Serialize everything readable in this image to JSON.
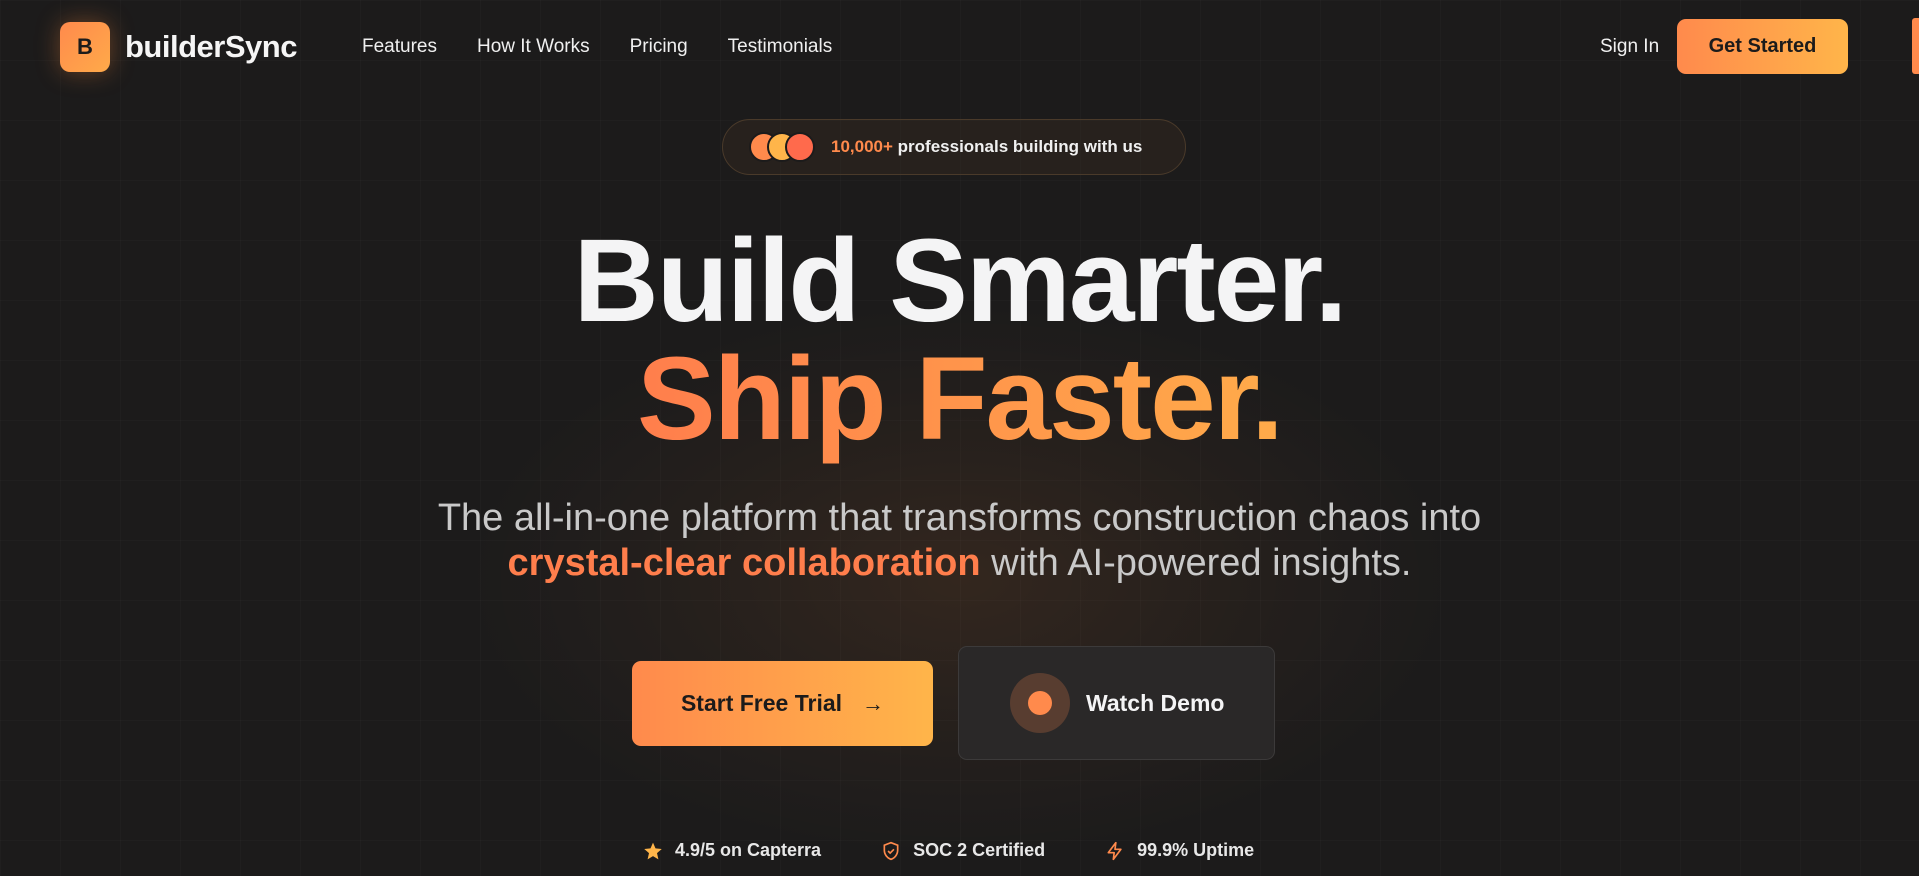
{
  "brand": {
    "logo_letter": "B",
    "name": "builderSync",
    "accent": "#ff8a4c",
    "accent_end": "#ffb54a"
  },
  "nav": {
    "links": [
      "Features",
      "How It Works",
      "Pricing",
      "Testimonials"
    ],
    "signin": "Sign In",
    "cta": "Get Started"
  },
  "badge": {
    "count": "10,000+",
    "text": " professionals building with us"
  },
  "hero": {
    "line1": "Build Smarter.",
    "line2": "Ship Faster.",
    "sub_line1": "The all-in-one platform that transforms construction chaos into",
    "sub_highlight": "crystal-clear collaboration",
    "sub_rest": " with AI-powered insights."
  },
  "buttons": {
    "primary": "Start Free Trial",
    "primary_icon": "arrow-right-icon",
    "demo": "Watch Demo",
    "demo_icon": "play-icon"
  },
  "trust": [
    {
      "icon": "star-icon",
      "label": "4.9/5 on Capterra"
    },
    {
      "icon": "shield-icon",
      "label": "SOC 2 Certified"
    },
    {
      "icon": "lightning-icon",
      "label": "99.9% Uptime"
    }
  ]
}
